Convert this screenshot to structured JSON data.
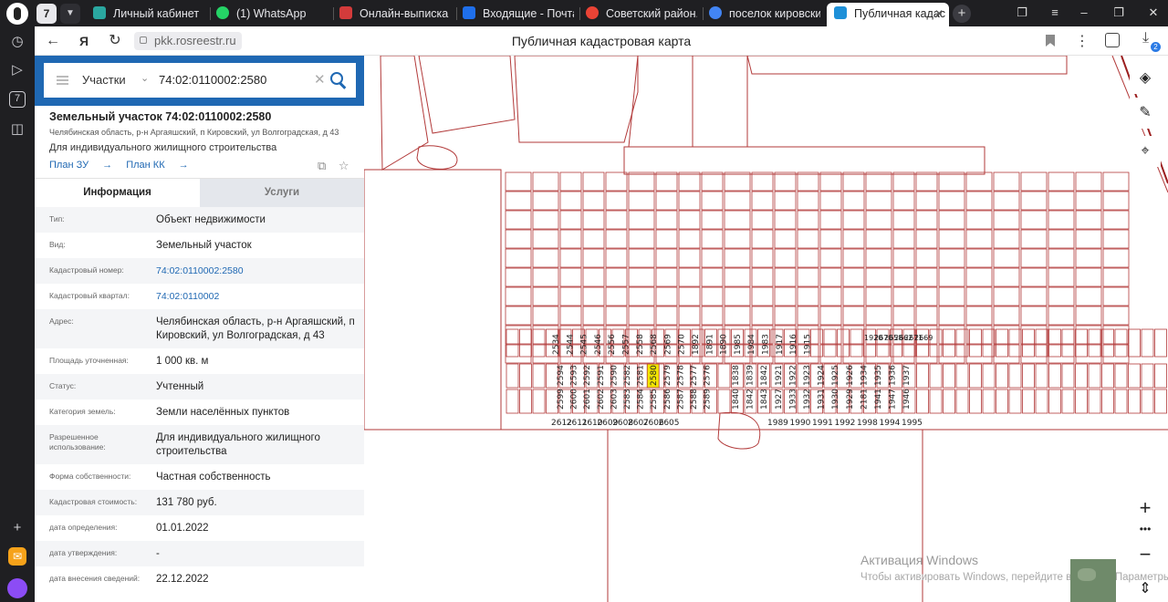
{
  "browser": {
    "tab_count": "7",
    "tabs": [
      {
        "title": "Личный кабинет",
        "color": "#2aa7a0"
      },
      {
        "title": "(1) WhatsApp",
        "color": "#25d366"
      },
      {
        "title": "Онлайн-выписка ЕГРН",
        "color": "#d33b3b"
      },
      {
        "title": "Входящие - Почта Mail.ru",
        "color": "#1f6feb"
      },
      {
        "title": "Советский район. Поиск",
        "color": "#ea4335"
      },
      {
        "title": "поселок кировский",
        "color": "#4285f4"
      },
      {
        "title": "Публичная кадастровая карта",
        "color": "#1e90d8"
      }
    ],
    "url": "pkk.rosreestr.ru",
    "page_title": "Публичная кадастровая карта",
    "downloads_badge": "2"
  },
  "search": {
    "type": "Участки",
    "query": "74:02:0110002:2580"
  },
  "parcel": {
    "title": "Земельный участок 74:02:0110002:2580",
    "address_line": "Челябинская область, р-н Аргаяшский, п Кировский, ул Волгоградская, д 43",
    "purpose": "Для индивидуального жилищного строительства",
    "link_plan_zu": "План ЗУ",
    "link_plan_kk": "План КК"
  },
  "panel_tabs": {
    "info": "Информация",
    "services": "Услуги"
  },
  "fields": [
    {
      "k": "Тип:",
      "v": "Объект недвижимости"
    },
    {
      "k": "Вид:",
      "v": "Земельный участок"
    },
    {
      "k": "Кадастровый номер:",
      "v": "74:02:0110002:2580",
      "link": true
    },
    {
      "k": "Кадастровый квартал:",
      "v": "74:02:0110002",
      "link": true
    },
    {
      "k": "Адрес:",
      "v": "Челябинская область, р-н Аргаяшский, п Кировский, ул Волгоградская, д 43"
    },
    {
      "k": "Площадь уточненная:",
      "v": "1 000 кв. м"
    },
    {
      "k": "Статус:",
      "v": "Учтенный"
    },
    {
      "k": "Категория земель:",
      "v": "Земли населённых пунктов"
    },
    {
      "k": "Разрешенное использование:",
      "v": "Для индивидуального жилищного строительства"
    },
    {
      "k": "Форма собственности:",
      "v": "Частная собственность"
    },
    {
      "k": "Кадастровая стоимость:",
      "v": "131 780 руб."
    },
    {
      "k": "дата определения:",
      "v": "01.01.2022"
    },
    {
      "k": "дата утверждения:",
      "v": "-"
    },
    {
      "k": "дата внесения сведений:",
      "v": "22.12.2022"
    }
  ],
  "map": {
    "highlight_color": "#f2e600",
    "line_color": "#c0392b",
    "selected_parcel": "2580",
    "bottom_row_labels": [
      "2612",
      "2611",
      "2610",
      "2609",
      "2608",
      "2607",
      "2606",
      "2605"
    ],
    "bottom_row_labels_right": [
      "1989",
      "1990",
      "1991",
      "1992",
      "1998",
      "1994",
      "1995"
    ],
    "block_a_top": [
      "2594",
      "2593",
      "2592",
      "2591",
      "2590",
      "2582",
      "2581",
      "2580",
      "2579",
      "2578",
      "2577",
      "2576"
    ],
    "block_a_bottom": [
      "2599",
      "2600",
      "2601",
      "2602",
      "2603",
      "2583",
      "2584",
      "2585",
      "2586",
      "2587",
      "2588",
      "2589"
    ],
    "block_b_top": [
      "1838",
      "1839",
      "1842",
      "1921",
      "1922",
      "1923",
      "1924",
      "1925",
      "1926",
      "1934",
      "1935",
      "1936",
      "1937"
    ],
    "block_b_bottom": [
      "1840",
      "1842",
      "1843",
      "1927",
      "1933",
      "1932",
      "1931",
      "1930",
      "1929",
      "2181",
      "1941",
      "1947",
      "1946"
    ],
    "row_mid": [
      "2534",
      "2544",
      "2545",
      "2546",
      "2556",
      "2557",
      "2558",
      "2568",
      "2569",
      "2570",
      "1892",
      "1891",
      "1890",
      "1985",
      "1984",
      "1983",
      "1917",
      "1916",
      "1915"
    ],
    "row_mid_right": [
      "1920",
      "2670",
      "2658",
      "2662",
      "2671",
      "2669"
    ],
    "watermark_title": "Активация Windows",
    "watermark_text": "Чтобы активировать Windows, перейдите в раздел \"Параметры\"."
  }
}
